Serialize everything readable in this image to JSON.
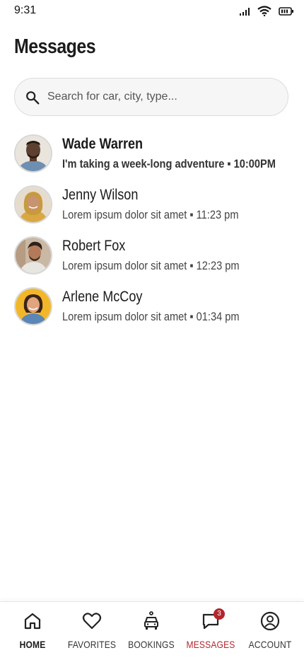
{
  "status_bar": {
    "time": "9:31"
  },
  "page_title": "Messages",
  "search": {
    "placeholder": "Search for car, city, type..."
  },
  "conversations": [
    {
      "name": "Wade Warren",
      "preview": "I'm taking a week-long adventure ▪ 10:00PM",
      "unread": true
    },
    {
      "name": "Jenny Wilson",
      "preview": "Lorem ipsum dolor sit amet ▪ 11:23 pm",
      "unread": false
    },
    {
      "name": "Robert Fox",
      "preview": "Lorem ipsum dolor sit amet ▪ 12:23 pm",
      "unread": false
    },
    {
      "name": "Arlene McCoy",
      "preview": "Lorem ipsum dolor sit amet ▪ 01:34 pm",
      "unread": false
    }
  ],
  "bottom_nav": {
    "items": [
      {
        "label": "HOME",
        "icon": "home-icon"
      },
      {
        "label": "FAVORITES",
        "icon": "heart-icon"
      },
      {
        "label": "BOOKINGS",
        "icon": "car-icon"
      },
      {
        "label": "MESSAGES",
        "icon": "chat-icon",
        "badge": "3"
      },
      {
        "label": "ACCOUNT",
        "icon": "account-icon"
      }
    ]
  },
  "colors": {
    "accent": "#b3262d",
    "text": "#1c1c1c",
    "search_bg": "#f6f6f6"
  }
}
